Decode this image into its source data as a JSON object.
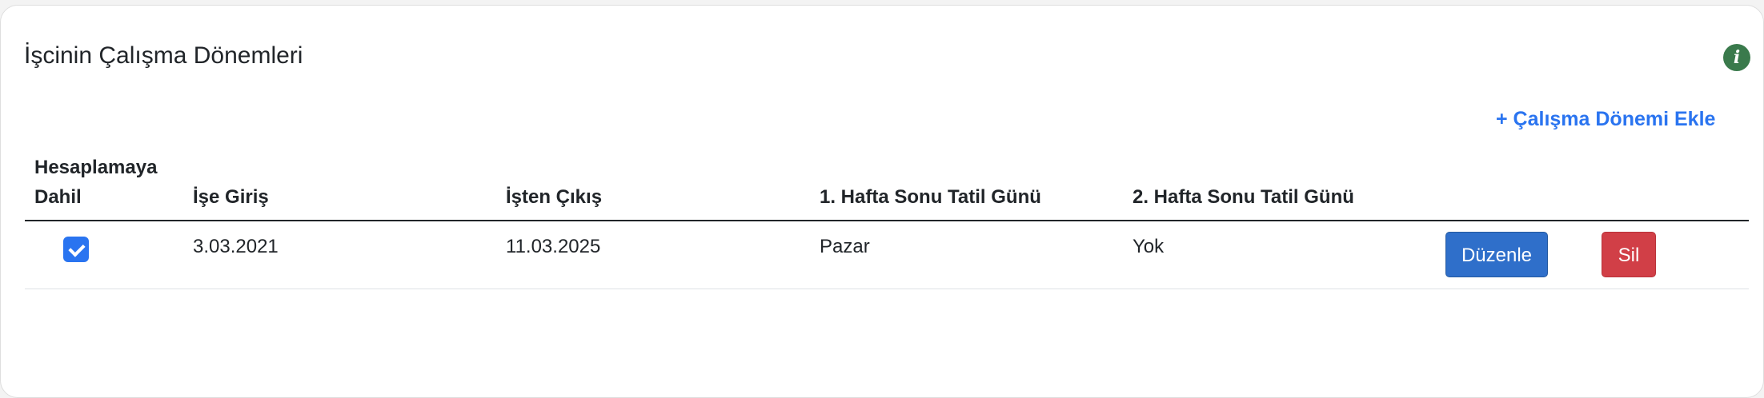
{
  "card": {
    "title": "İşcinin Çalışma Dönemleri",
    "info_icon_glyph": "i",
    "add_link": "+ Çalışma Dönemi Ekle"
  },
  "table": {
    "headers": {
      "included": "Hesaplamaya Dahil",
      "start": "İşe Giriş",
      "end": "İşten Çıkış",
      "weekend1": "1. Hafta Sonu Tatil Günü",
      "weekend2": "2. Hafta Sonu Tatil Günü"
    },
    "rows": [
      {
        "included": true,
        "start": "3.03.2021",
        "end": "11.03.2025",
        "weekend1": "Pazar",
        "weekend2": "Yok",
        "edit_label": "Düzenle",
        "delete_label": "Sil"
      }
    ]
  },
  "colors": {
    "accent": "#2a74f0",
    "edit_button": "#2f6fca",
    "delete_button": "#d13f47",
    "info_icon": "#3a7a4c"
  }
}
